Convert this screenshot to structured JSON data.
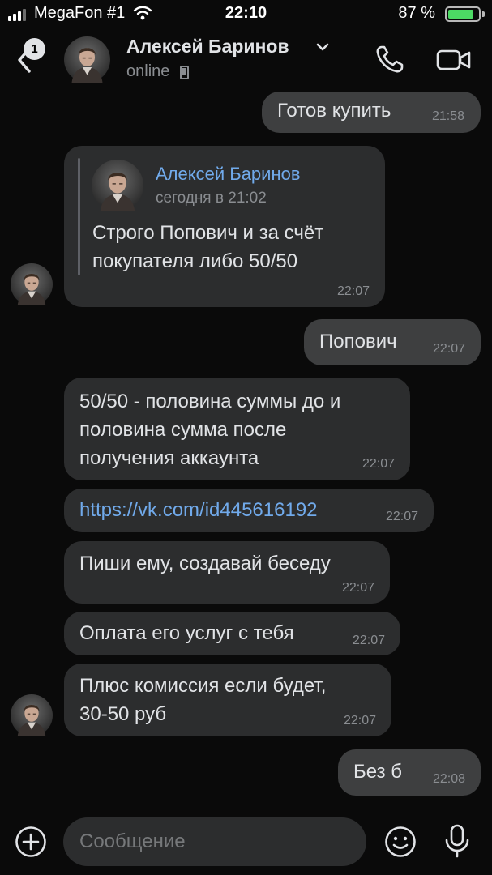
{
  "status_bar": {
    "carrier": "MegaFon #1",
    "time": "22:10",
    "battery_percent": "87 %",
    "battery_level": 0.87,
    "battery_color": "#4cd964"
  },
  "header": {
    "back_badge": "1",
    "contact_name": "Алексей Баринов",
    "status": "online",
    "icons": [
      "back-chevron-icon",
      "chevron-down-icon",
      "phone-icon",
      "video-camera-icon",
      "mobile-device-icon"
    ]
  },
  "messages": [
    {
      "direction": "out",
      "text": "Готов купить",
      "time": "21:58"
    },
    {
      "direction": "in",
      "reply": {
        "author": "Алексей Баринов",
        "date": "сегодня в 21:02"
      },
      "text": "Строго Попович и за счёт\nпокупателя либо 50/50",
      "time": "22:07"
    },
    {
      "direction": "out",
      "text": "Попович",
      "time": "22:07"
    },
    {
      "direction": "in",
      "text": "50/50 - половина суммы до и\nполовина сумма после\nполучения аккаунта",
      "time": "22:07"
    },
    {
      "direction": "in",
      "text": "https://vk.com/id445616192",
      "time": "22:07",
      "is_link": true
    },
    {
      "direction": "in",
      "text": "Пиши ему, создавай беседу",
      "time": "22:07"
    },
    {
      "direction": "in",
      "text": "Оплата его услуг с тебя",
      "time": "22:07"
    },
    {
      "direction": "in",
      "text": "Плюс комиссия если будет,\n30-50 руб",
      "time": "22:07"
    },
    {
      "direction": "out",
      "text": "Без б",
      "time": "22:08"
    }
  ],
  "composer": {
    "placeholder": "Сообщение",
    "icons": [
      "plus-circle-icon",
      "smiley-icon",
      "microphone-icon"
    ]
  },
  "colors": {
    "background": "#0a0a0a",
    "bubble_in": "#2c2d2e",
    "bubble_out": "#3e3f40",
    "accent": "#71aaeb",
    "secondary_text": "#8a8d91"
  }
}
